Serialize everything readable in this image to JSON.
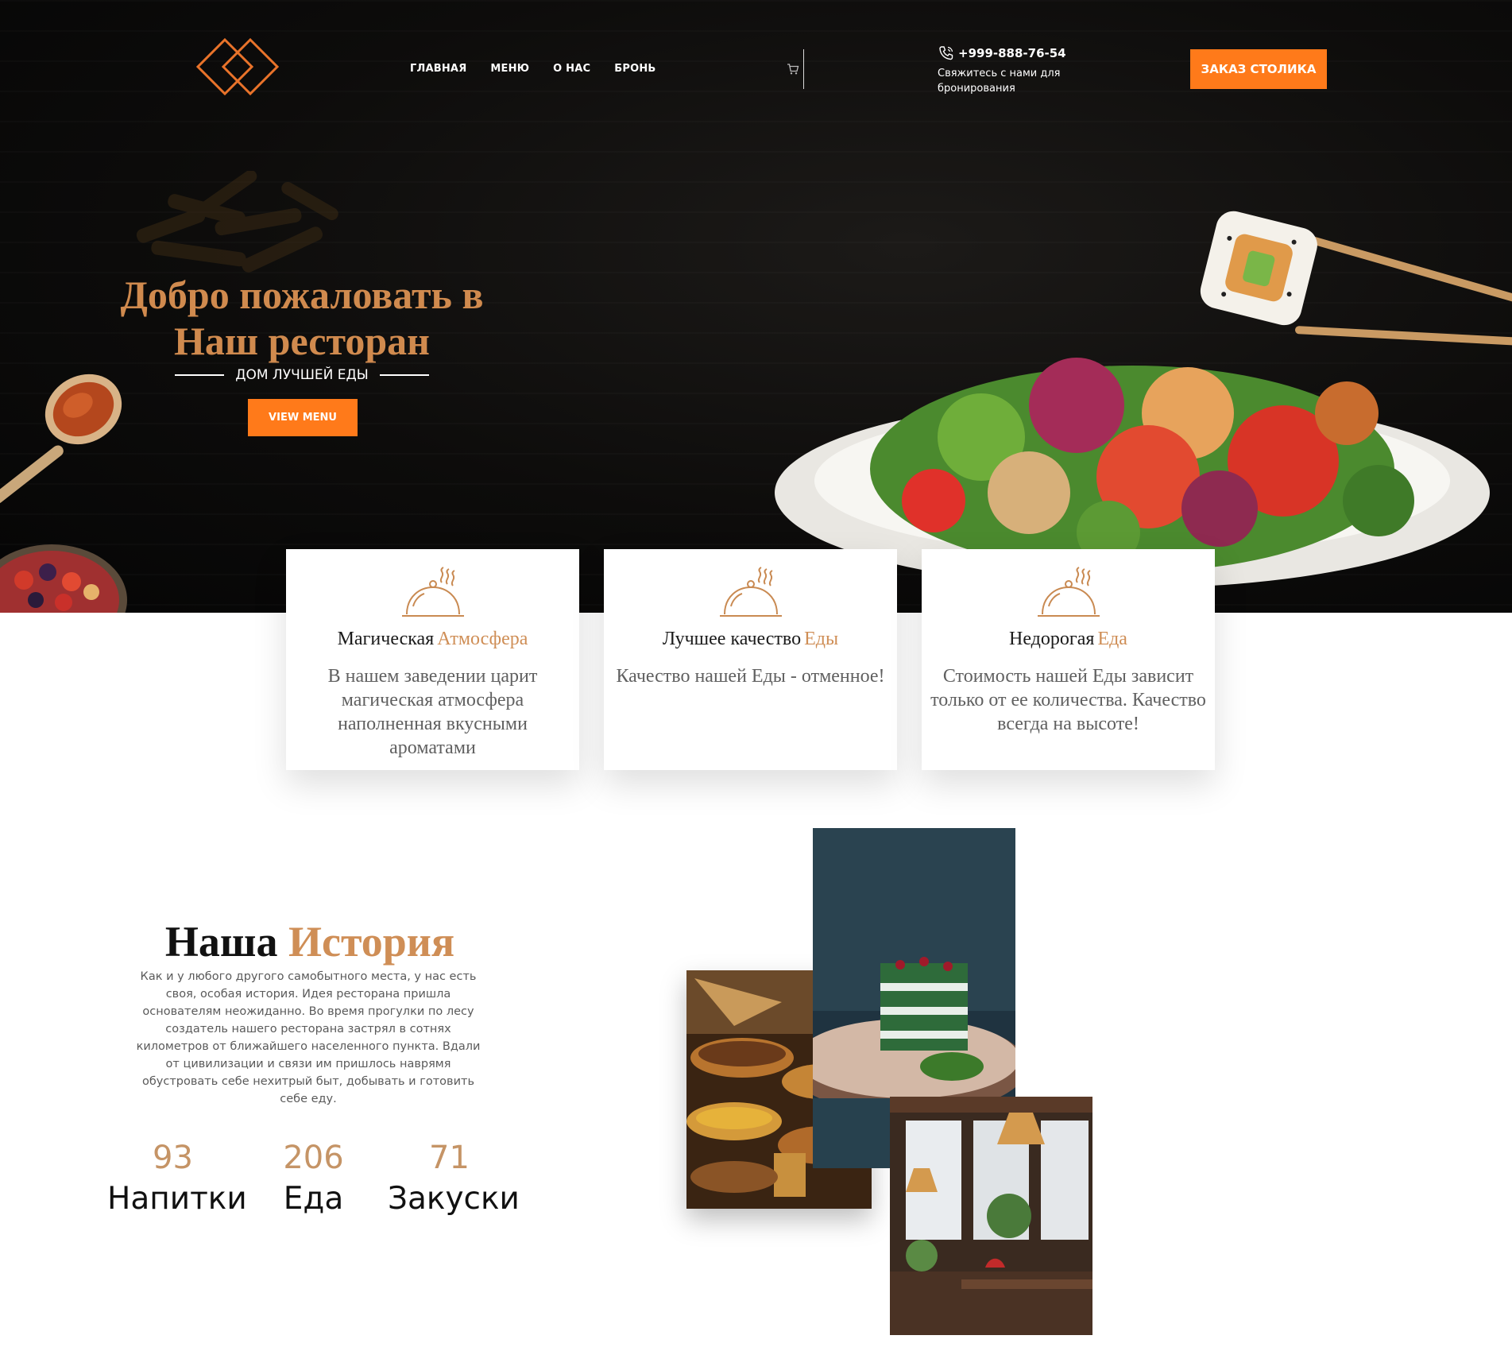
{
  "nav": {
    "items": [
      "ГЛАВНАЯ",
      "МЕНЮ",
      "О НАС",
      "БРОНЬ"
    ]
  },
  "contact": {
    "phone": "+999-888-76-54",
    "subtitle": "Свяжитесь с нами для бронирования"
  },
  "reserve_button": "ЗАКАЗ СТОЛИКА",
  "hero": {
    "title_line1": "Добро пожаловать в",
    "title_line2": "Наш ресторан",
    "subtitle": "ДОМ ЛУЧШЕЙ ЕДЫ",
    "cta": "VIEW MENU"
  },
  "features": [
    {
      "title": "Магическая",
      "accent": "Атмосфера",
      "text": "В нашем заведении царит магическая атмосфера наполненная вкусными ароматами"
    },
    {
      "title": "Лучшее качество",
      "accent": "Еды",
      "text": "Качество нашей Еды - отменное!"
    },
    {
      "title": "Недорогая",
      "accent": "Еда",
      "text": "Стоимость нашей Еды зависит только от ее количества. Качество всегда на высоте!"
    }
  ],
  "history": {
    "title": "Наша",
    "accent": "История",
    "text": "Как и у любого другого самобытного места, у нас есть своя, особая история. Идея ресторана пришла основателям неожиданно. Во время прогулки по лесу создатель нашего ресторана застрял в сотнях километров от ближайшего населенного пункта. Вдали от цивилизации и связи им пришлось наврямя обустровать себе нехитрый быт, добывать и готовить себе еду."
  },
  "stats": [
    {
      "value": "93",
      "label": "Напитки"
    },
    {
      "value": "206",
      "label": "Еда"
    },
    {
      "value": "71",
      "label": "Закуски"
    }
  ],
  "colors": {
    "accent_orange": "#ff7a1a",
    "accent_copper": "#cf8e56",
    "hero_bg": "#0d0c0b"
  },
  "icons": {
    "logo": "double-diamond-logo",
    "cart": "cart-icon",
    "phone": "phone-icon",
    "feature": "cloche-icon"
  }
}
